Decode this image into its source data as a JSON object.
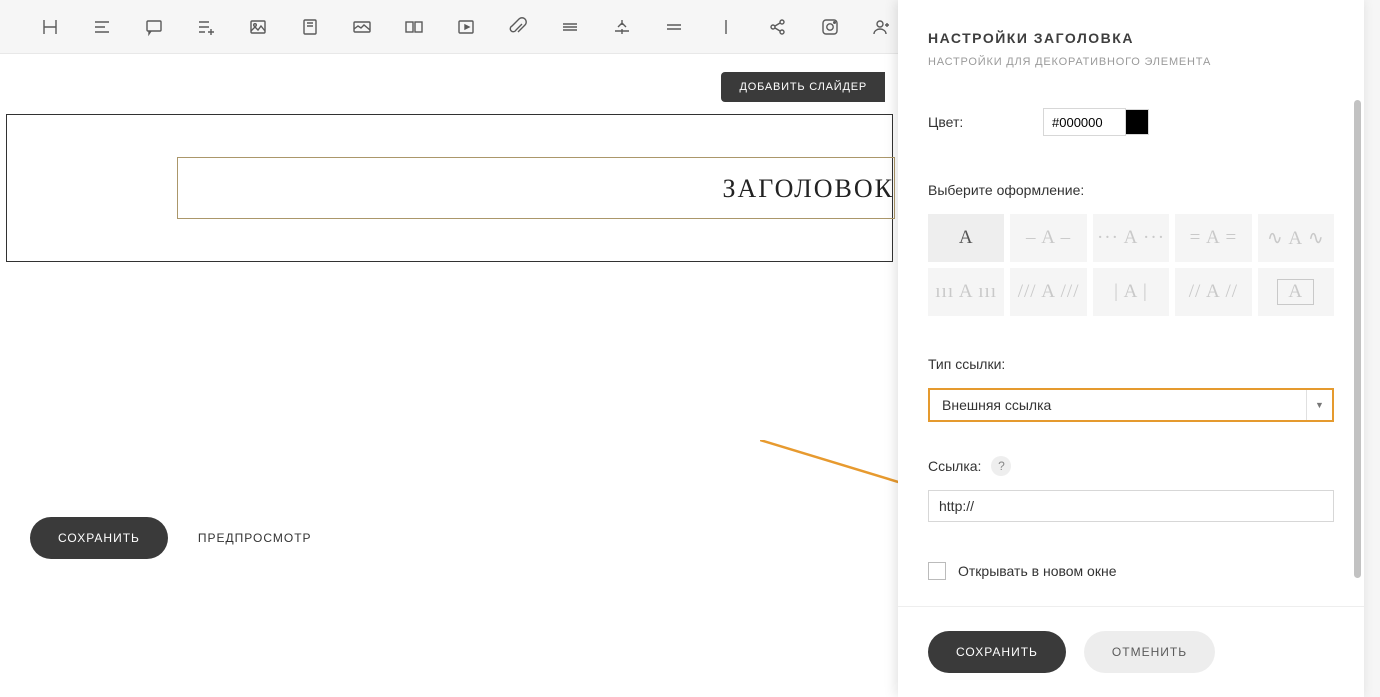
{
  "toolbar": {
    "icons": [
      "heading",
      "align",
      "comment",
      "list-plus",
      "image",
      "image-alt",
      "image-wide",
      "gallery",
      "video",
      "attachment",
      "divider",
      "anchor",
      "hr",
      "vline",
      "share",
      "instagram",
      "add-user"
    ]
  },
  "main": {
    "add_slider": "ДОБАВИТЬ СЛАЙДЕР",
    "heading_text": "ЗАГОЛОВОК",
    "save": "СОХРАНИТЬ",
    "preview": "ПРЕДПРОСМОТР"
  },
  "panel": {
    "title": "НАСТРОЙКИ ЗАГОЛОВКА",
    "subtitle": "НАСТРОЙКИ ДЛЯ ДЕКОРАТИВНОГО ЭЛЕМЕНТА",
    "color_label": "Цвет:",
    "color_value": "#000000",
    "style_label": "Выберите оформление:",
    "styles": [
      "A",
      "– A –",
      "··· A ···",
      "= A =",
      "∿ A ∿",
      "ııı A ııı",
      "/// A ///",
      "| A |",
      "// A //",
      "[A]"
    ],
    "link_type_label": "Тип ссылки:",
    "link_type_value": "Внешняя ссылка",
    "url_label": "Ссылка:",
    "url_value": "http://",
    "open_new_label": "Открывать в новом окне",
    "save": "СОХРАНИТЬ",
    "cancel": "ОТМЕНИТЬ"
  }
}
